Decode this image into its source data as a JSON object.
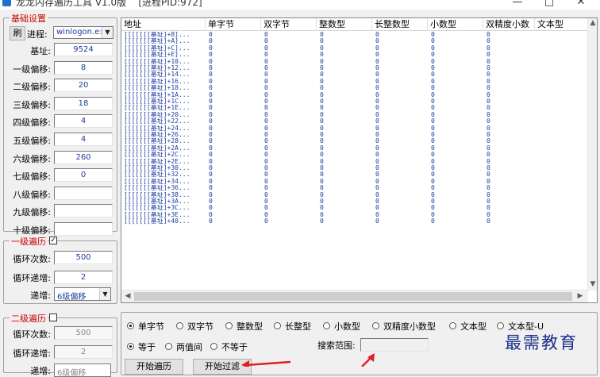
{
  "window": {
    "title": "龙龙内存遍历工具 V1.0版",
    "pid_label": "[进程PID:972]",
    "controls": {
      "minimize": "—",
      "maximize": "□",
      "close": "✕"
    }
  },
  "base_group": {
    "legend": "基础设置",
    "refresh_button": "刷",
    "process_label": "进程:",
    "process_value": "winlogon.e:",
    "fields": [
      {
        "label": "基址:",
        "value": "9524"
      },
      {
        "label": "一级偏移:",
        "value": "8"
      },
      {
        "label": "二级偏移:",
        "value": "20"
      },
      {
        "label": "三级偏移:",
        "value": "18"
      },
      {
        "label": "四级偏移:",
        "value": "4"
      },
      {
        "label": "五级偏移:",
        "value": "4"
      },
      {
        "label": "六级偏移:",
        "value": "260"
      },
      {
        "label": "七级偏移:",
        "value": "0"
      },
      {
        "label": "八级偏移:",
        "value": ""
      },
      {
        "label": "九级偏移:",
        "value": ""
      },
      {
        "label": "十级偏移:",
        "value": ""
      }
    ]
  },
  "traverse1": {
    "legend": "一级遍历",
    "checked": true,
    "loop_label": "循环次数:",
    "loop_value": "500",
    "step_label": "循环递增:",
    "step_value": "2",
    "target_label": "递增:",
    "target_value": "6级偏移"
  },
  "traverse2": {
    "legend": "二级遍历",
    "checked": false,
    "loop_label": "循环次数:",
    "loop_value": "500",
    "step_label": "循环递增:",
    "step_value": "2",
    "target_label": "递增:",
    "target_value": "6级偏移"
  },
  "table": {
    "columns": [
      "地址",
      "单字节",
      "双字节",
      "整数型",
      "长整数型",
      "小数型",
      "双精度小数",
      "文本型"
    ],
    "rows": [
      [
        "[[[[[[[基址]+8]...",
        "0",
        "0",
        "0",
        "0",
        "0",
        "0"
      ],
      [
        "[[[[[[[基址]+A]...",
        "0",
        "0",
        "0",
        "0",
        "0",
        "0"
      ],
      [
        "[[[[[[[基址]+C]...",
        "0",
        "0",
        "0",
        "0",
        "0",
        "0"
      ],
      [
        "[[[[[[[基址]+E]...",
        "0",
        "0",
        "0",
        "0",
        "0",
        "0"
      ],
      [
        "[[[[[[[基址]+10...",
        "0",
        "0",
        "0",
        "0",
        "0",
        "0"
      ],
      [
        "[[[[[[[基址]+12...",
        "0",
        "0",
        "0",
        "0",
        "0",
        "0"
      ],
      [
        "[[[[[[[基址]+14...",
        "0",
        "0",
        "0",
        "0",
        "0",
        "0"
      ],
      [
        "[[[[[[[基址]+16...",
        "0",
        "0",
        "0",
        "0",
        "0",
        "0"
      ],
      [
        "[[[[[[[基址]+18...",
        "0",
        "0",
        "0",
        "0",
        "0",
        "0"
      ],
      [
        "[[[[[[[基址]+1A...",
        "0",
        "0",
        "0",
        "0",
        "0",
        "0"
      ],
      [
        "[[[[[[[基址]+1C...",
        "0",
        "0",
        "0",
        "0",
        "0",
        "0"
      ],
      [
        "[[[[[[[基址]+1E...",
        "0",
        "0",
        "0",
        "0",
        "0",
        "0"
      ],
      [
        "[[[[[[[基址]+20...",
        "0",
        "0",
        "0",
        "0",
        "0",
        "0"
      ],
      [
        "[[[[[[[基址]+22...",
        "0",
        "0",
        "0",
        "0",
        "0",
        "0"
      ],
      [
        "[[[[[[[基址]+24...",
        "0",
        "0",
        "0",
        "0",
        "0",
        "0"
      ],
      [
        "[[[[[[[基址]+26...",
        "0",
        "0",
        "0",
        "0",
        "0",
        "0"
      ],
      [
        "[[[[[[[基址]+28...",
        "0",
        "0",
        "0",
        "0",
        "0",
        "0"
      ],
      [
        "[[[[[[[基址]+2A...",
        "0",
        "0",
        "0",
        "0",
        "0",
        "0"
      ],
      [
        "[[[[[[[基址]+2C...",
        "0",
        "0",
        "0",
        "0",
        "0",
        "0"
      ],
      [
        "[[[[[[[基址]+2E...",
        "0",
        "0",
        "0",
        "0",
        "0",
        "0"
      ],
      [
        "[[[[[[[基址]+30...",
        "0",
        "0",
        "0",
        "0",
        "0",
        "0"
      ],
      [
        "[[[[[[[基址]+32...",
        "0",
        "0",
        "0",
        "0",
        "0",
        "0"
      ],
      [
        "[[[[[[[基址]+34...",
        "0",
        "0",
        "0",
        "0",
        "0",
        "0"
      ],
      [
        "[[[[[[[基址]+36...",
        "0",
        "0",
        "0",
        "0",
        "0",
        "0"
      ],
      [
        "[[[[[[[基址]+38...",
        "0",
        "0",
        "0",
        "0",
        "0",
        "0"
      ],
      [
        "[[[[[[[基址]+3A...",
        "0",
        "0",
        "0",
        "0",
        "0",
        "0"
      ],
      [
        "[[[[[[[基址]+3C...",
        "0",
        "0",
        "0",
        "0",
        "0",
        "0"
      ],
      [
        "[[[[[[[基址]+3E...",
        "0",
        "0",
        "0",
        "0",
        "0",
        "0"
      ],
      [
        "[[[[[[[基址]+40...",
        "0",
        "0",
        "0",
        "0",
        "0",
        "0"
      ]
    ]
  },
  "options": {
    "types": [
      "单字节",
      "双字节",
      "整数型",
      "长整型",
      "小数型",
      "双精度小数型",
      "文本型",
      "文本型-U"
    ],
    "selected_type": "单字节",
    "compare": [
      "等于",
      "两值间",
      "不等于"
    ],
    "selected_compare": "等于",
    "search_range_label": "搜索范围:",
    "search_range_value": ""
  },
  "actions": {
    "start_traverse": "开始遍历",
    "start_filter": "开始过滤"
  },
  "watermark": "最需教育",
  "colors": {
    "legend": "#cc0000",
    "value_text": "#1f3e9c",
    "annotation_arrow": "#e02020"
  }
}
